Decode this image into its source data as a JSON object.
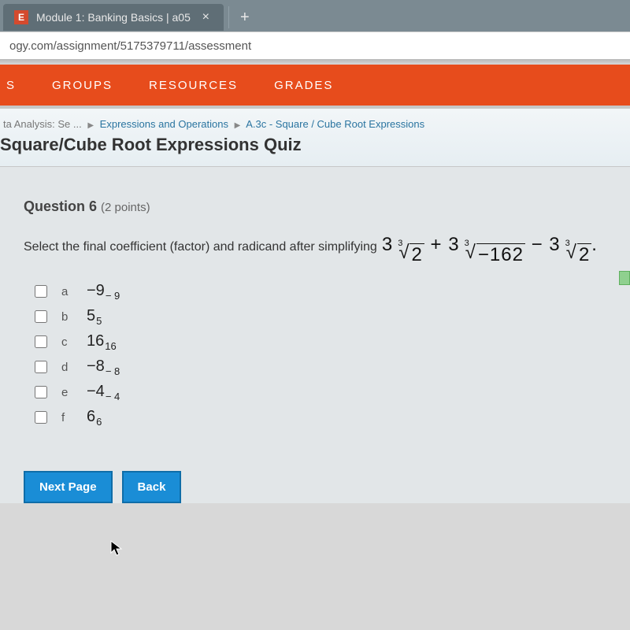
{
  "tab": {
    "favicon": "E",
    "title": "Module 1: Banking Basics | a05"
  },
  "url": "ogy.com/assignment/5175379711/assessment",
  "nav": {
    "cut": "S",
    "groups": "GROUPS",
    "resources": "RESOURCES",
    "grades": "GRADES"
  },
  "breadcrumb": {
    "seg0": "ta Analysis: Se ...",
    "seg1": "Expressions and Operations",
    "seg2": "A.3c - Square / Cube Root Expressions"
  },
  "page_title": "Square/Cube Root Expressions Quiz",
  "question": {
    "label": "Question 6",
    "points": "(2 points)",
    "prompt_pre": "Select the final coefficient (factor) and radicand after simplifying",
    "math_latex": "3\\sqrt[3]{2} + 3\\sqrt[3]{-162} - 3\\sqrt[3]{2}"
  },
  "math_parts": {
    "t1_coef": "3",
    "t1_idx": "3",
    "t1_rad": "2",
    "plus": " + ",
    "t2_coef": "3",
    "t2_idx": "3",
    "t2_rad": "−162",
    "minus": " − ",
    "t3_coef": "3",
    "t3_idx": "3",
    "t3_rad": "2",
    "trail": "."
  },
  "options": [
    {
      "letter": "a",
      "main": "−9",
      "dup": "− 9"
    },
    {
      "letter": "b",
      "main": "5",
      "dup": "5"
    },
    {
      "letter": "c",
      "main": "16",
      "dup": "16"
    },
    {
      "letter": "d",
      "main": "−8",
      "dup": "− 8"
    },
    {
      "letter": "e",
      "main": "−4",
      "dup": "− 4"
    },
    {
      "letter": "f",
      "main": "6",
      "dup": "6"
    }
  ],
  "buttons": {
    "next": "Next Page",
    "back": "Back"
  }
}
